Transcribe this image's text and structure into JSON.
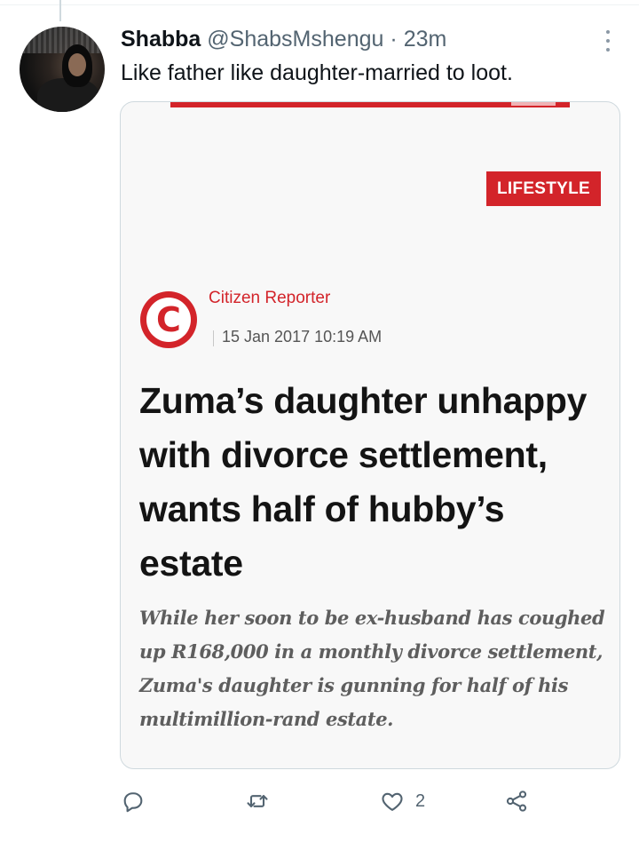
{
  "tweet": {
    "display_name": "Shabba",
    "handle": "@ShabsMshengu",
    "separator": "·",
    "time": "23m",
    "text": "Like father like daughter-married to loot."
  },
  "card": {
    "category_tag": "LIFESTYLE",
    "logo_letter": "C",
    "reporter": "Citizen Reporter",
    "date": "15 Jan 2017 10:19 AM",
    "headline": "Zuma’s daughter unhappy with divorce settlement, wants half of hubby’s estate",
    "standfirst": "While her soon to be ex-husband has coughed up R168,000 in a monthly divorce settlement, Zuma's daughter is gunning for half of his multimillion-rand estate.",
    "brand_color": "#d3242a"
  },
  "actions": {
    "reply_icon": "reply-icon",
    "retweet_icon": "retweet-icon",
    "like_icon": "heart-icon",
    "like_count": "2",
    "share_icon": "share-icon"
  }
}
